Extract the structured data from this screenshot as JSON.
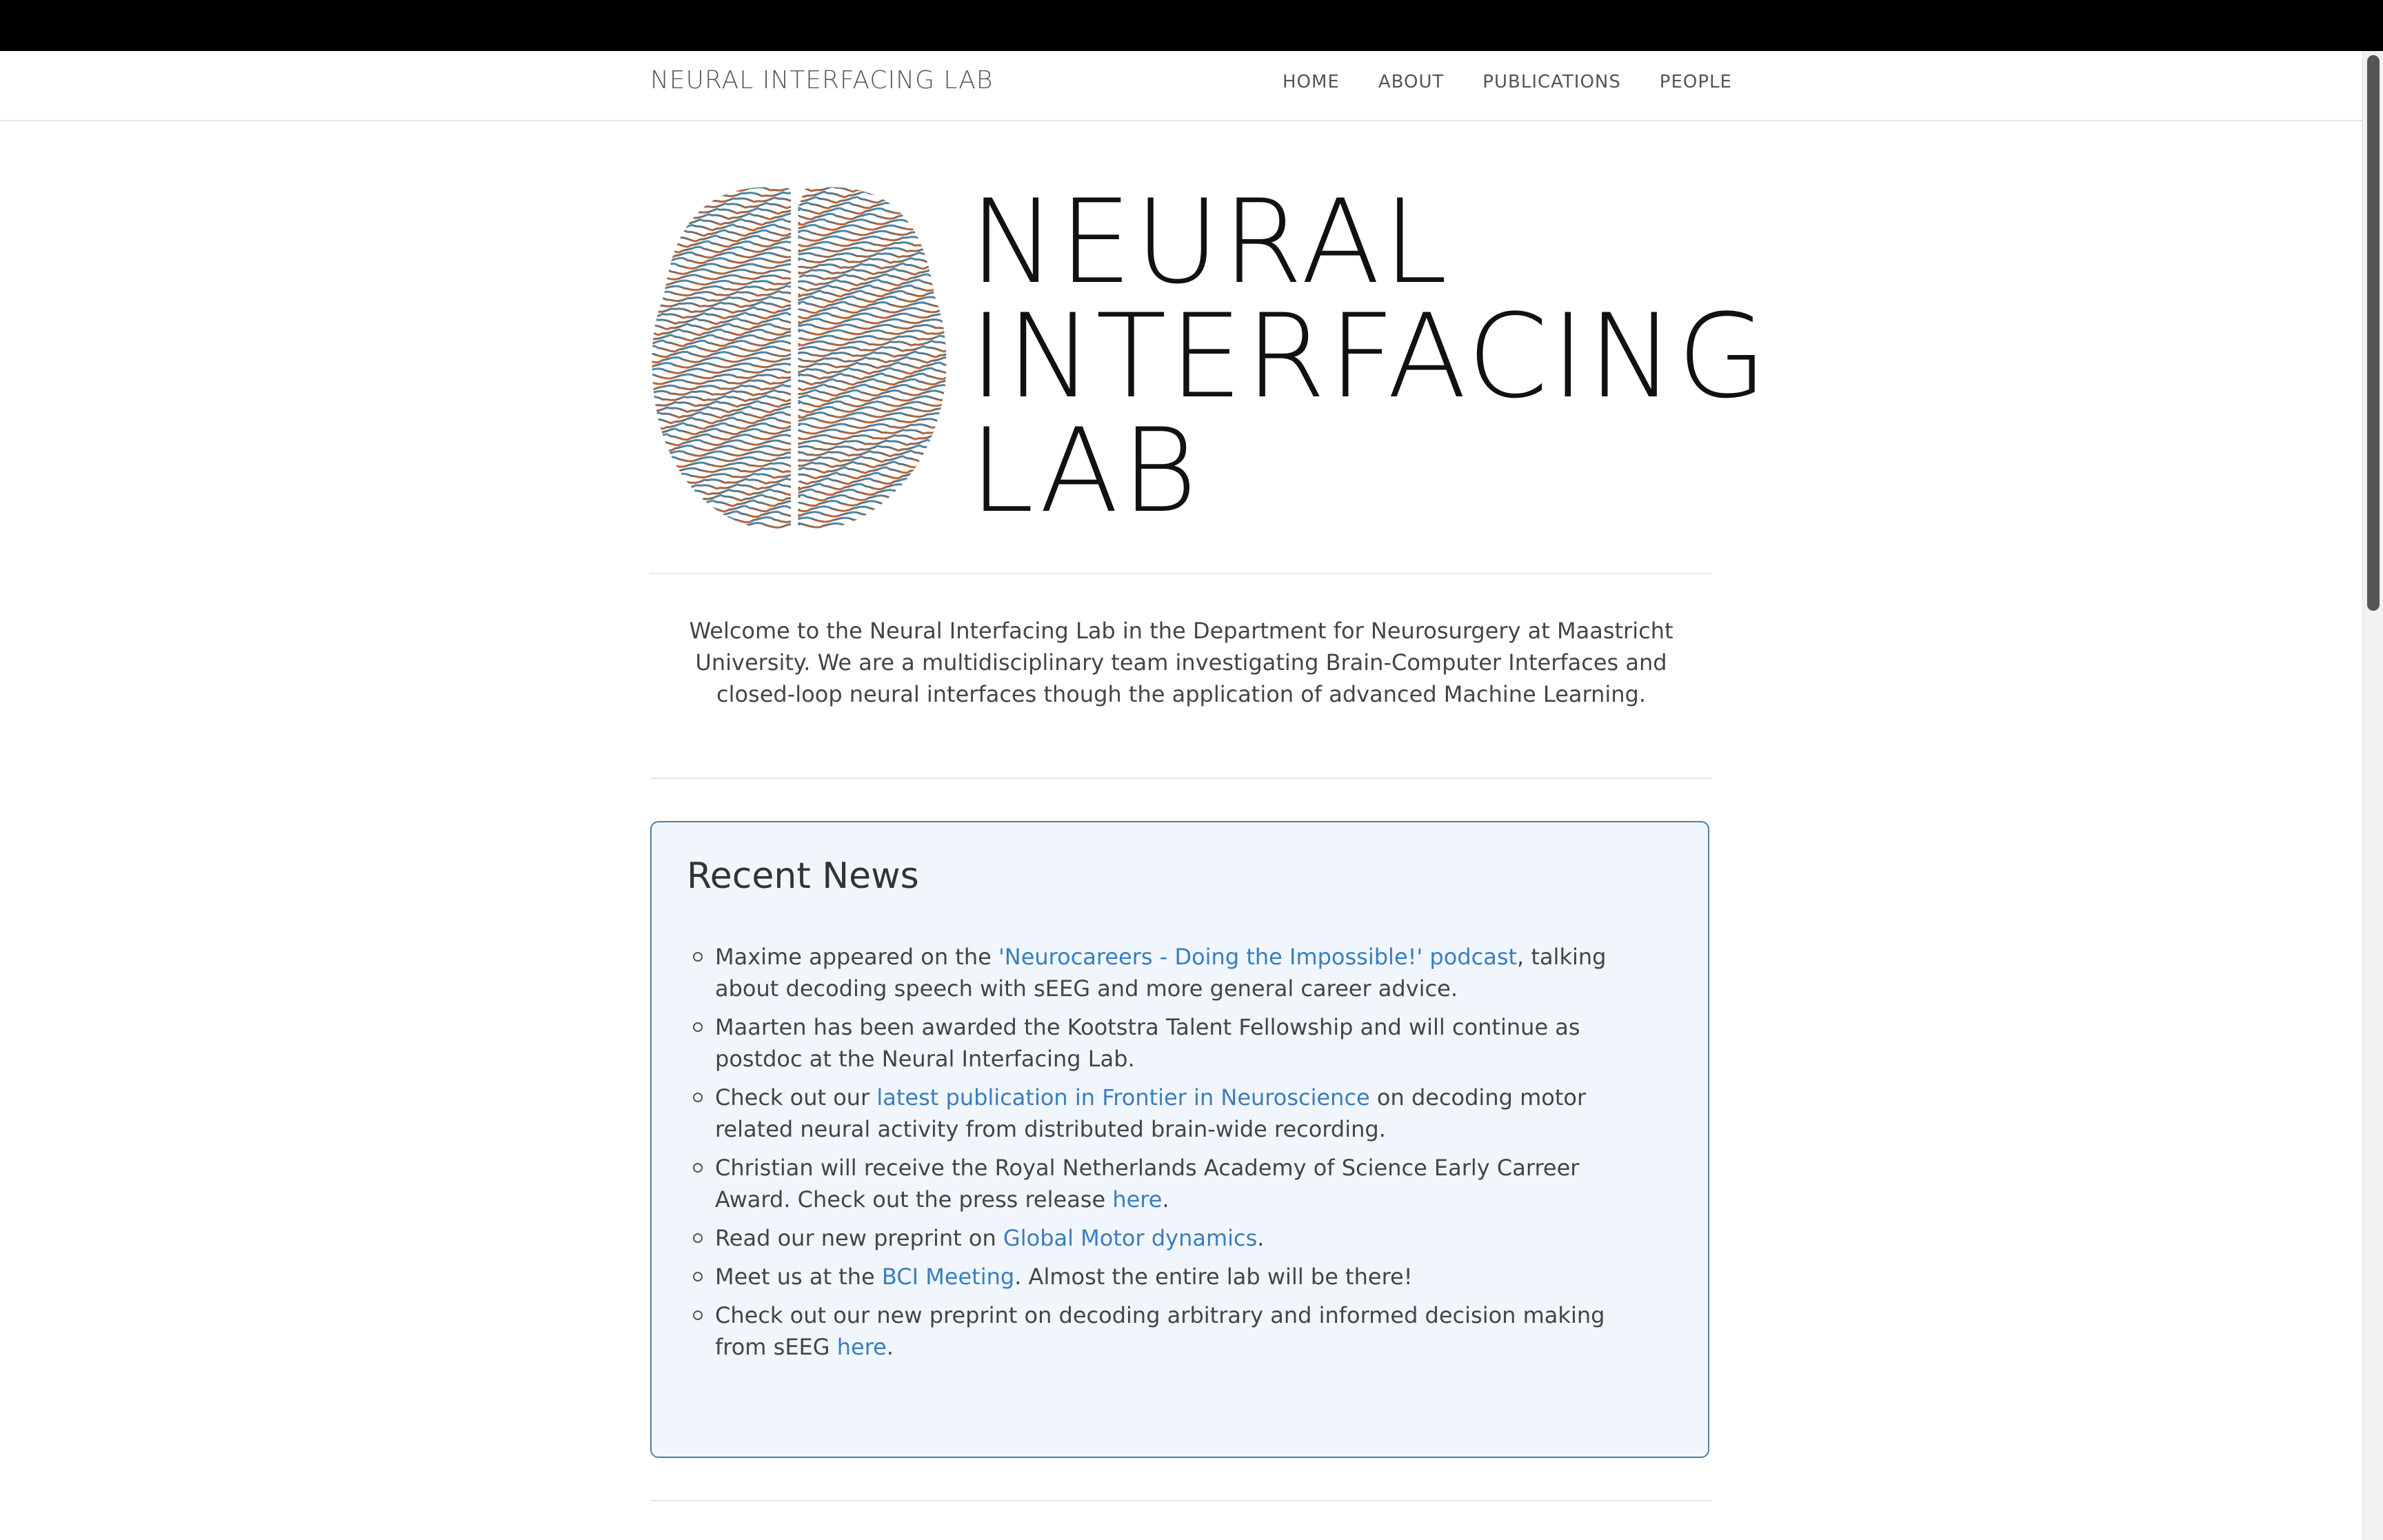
{
  "nav": {
    "brand": "NEURAL INTERFACING LAB",
    "links": [
      "HOME",
      "ABOUT",
      "PUBLICATIONS",
      "PEOPLE"
    ]
  },
  "hero": {
    "title_lines": [
      "NEURAL",
      "INTERFACING",
      "LAB"
    ],
    "logo_icon": "brain-wave-logo-icon"
  },
  "welcome": "Welcome to the Neural Interfacing Lab in the Department for Neurosurgery at Maastricht University. We are a multidisciplinary team investigating Brain-Computer Interfaces and closed-loop neural interfaces though the application of advanced Machine Learning.",
  "news": {
    "title": "Recent News",
    "items": [
      {
        "before": "Maxime appeared on the ",
        "link": "'Neurocareers - Doing the Impossible!' podcast",
        "after": ", talking about decoding speech with sEEG and more general career advice."
      },
      {
        "before": "Maarten has been awarded the Kootstra Talent Fellowship and will continue as postdoc at the Neural Interfacing Lab.",
        "link": "",
        "after": ""
      },
      {
        "before": "Check out our ",
        "link": "latest publication in Frontier in Neuroscience",
        "after": " on decoding motor related neural activity from distributed brain-wide recording."
      },
      {
        "before": "Christian will receive the Royal Netherlands Academy of Science Early Carreer Award. Check out the press release ",
        "link": "here",
        "after": "."
      },
      {
        "before": "Read our new preprint on ",
        "link": "Global Motor dynamics",
        "after": "."
      },
      {
        "before": "Meet us at the ",
        "link": "BCI Meeting",
        "after": ". Almost the entire lab will be there!"
      },
      {
        "before": "Check out our new preprint on decoding arbitrary and informed decision making from sEEG ",
        "link": "here",
        "after": "."
      }
    ]
  },
  "colors": {
    "link": "#3a7dbf",
    "news_background": "#f0f6fc",
    "news_border": "#4f7ea3",
    "brain_top": "#3f8fbf",
    "brain_middle": "#6b6b6b",
    "brain_bottom": "#d0622a"
  }
}
